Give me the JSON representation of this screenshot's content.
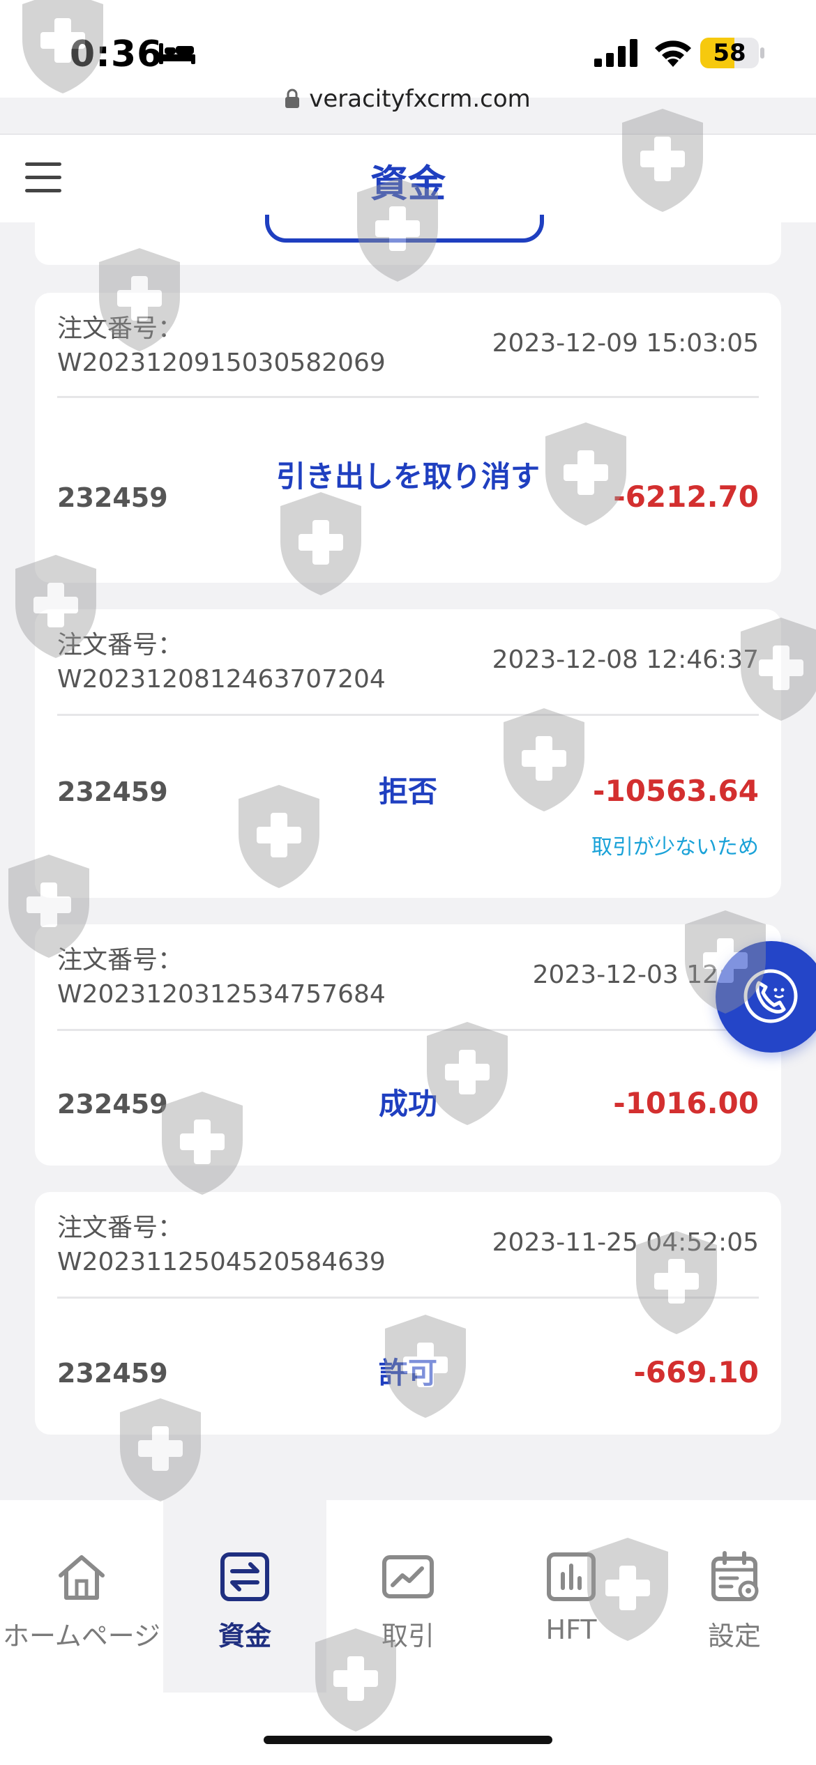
{
  "status_bar": {
    "time": "0:36",
    "battery": "58",
    "battery_level": 0.58,
    "url": "veracityfxcrm.com"
  },
  "header": {
    "title": "資金",
    "menu_icon": "hamburger-menu-icon"
  },
  "colors": {
    "brand_blue": "#1f3fc0",
    "amount_red": "#d32f2f",
    "reason_cyan": "#1aa2d8",
    "battery_yellow": "#f6c90e"
  },
  "orders": [
    {
      "label": "注文番号：",
      "number": "W2023120915030582069",
      "date": "2023-12-09 15:03:05",
      "account": "232459",
      "status": "引き出しを取り消す",
      "amount": "-6212.70",
      "reason": ""
    },
    {
      "label": "注文番号：",
      "number": "W2023120812463707204",
      "date": "2023-12-08 12:46:37",
      "account": "232459",
      "status": "拒否",
      "amount": "-10563.64",
      "reason": "取引が少ないため"
    },
    {
      "label": "注文番号：",
      "number": "W2023120312534757684",
      "date": "2023-12-03 12:53",
      "account": "232459",
      "status": "成功",
      "amount": "-1016.00",
      "reason": ""
    },
    {
      "label": "注文番号：",
      "number": "W2023112504520584639",
      "date": "2023-11-25 04:52:05",
      "account": "232459",
      "status": "許可",
      "amount": "-669.10",
      "reason": ""
    }
  ],
  "floating_button": {
    "icon": "phone-support-icon"
  },
  "bottom_nav": [
    {
      "label": "ホームページ",
      "icon": "home-icon",
      "active": false
    },
    {
      "label": "資金",
      "icon": "funds-transfer-icon",
      "active": true
    },
    {
      "label": "取引",
      "icon": "trading-chart-icon",
      "active": false
    },
    {
      "label": "HFT",
      "icon": "bar-chart-icon",
      "active": false
    },
    {
      "label": "設定",
      "icon": "calendar-settings-icon",
      "active": false
    }
  ]
}
